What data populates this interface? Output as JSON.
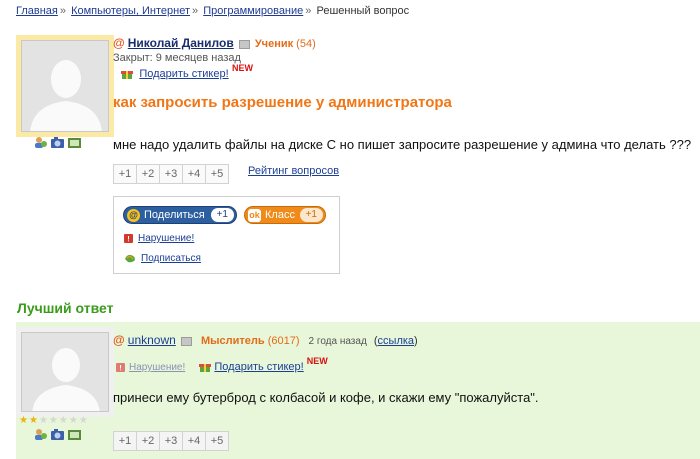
{
  "breadcrumb": {
    "items": [
      "Главная",
      "Компьютеры, Интернет",
      "Программирование"
    ],
    "current": "Решенный вопрос",
    "separator": "»"
  },
  "question": {
    "author": {
      "name": "Николай Данилов",
      "rank": "Ученик",
      "points": "(54)"
    },
    "closed": "Закрыт: 9 месяцев назад",
    "sticker_link": "Подарить стикер!",
    "new_badge": "NEW",
    "title": "как запросить разрешение у администратора",
    "text": "мне надо удалить файлы на диске С но пишет запросите разрешение у админа что делать ???",
    "votes": [
      "+1",
      "+2",
      "+3",
      "+4",
      "+5"
    ],
    "rating_link": "Рейтинг вопросов",
    "share": {
      "share_label": "Поделиться",
      "share_count": "+1",
      "class_label": "Класс",
      "class_count": "+1",
      "violation": "Нарушение!",
      "subscribe": "Подписаться"
    }
  },
  "best_answer": {
    "heading": "Лучший ответ",
    "author": {
      "name": "unknown",
      "rank": "Мыслитель",
      "points": "(6017)"
    },
    "time": "2 года назад",
    "link": "ссылка",
    "violation": "Нарушение!",
    "sticker_link": "Подарить стикер!",
    "new_badge": "NEW",
    "text": "принеси ему бутерброд с колбасой и кофе, и скажи ему \"пожалуйста\".",
    "votes": [
      "+1",
      "+2",
      "+3",
      "+4",
      "+5"
    ],
    "stars_filled": 2,
    "stars_total": 7
  },
  "colors": {
    "link": "#1c3f96",
    "title_orange": "#f07616",
    "rank_orange": "#e56b1a",
    "best_green": "#3b9b1c",
    "answer_bg": "#e8f6d9"
  },
  "icons": [
    "at-icon",
    "mailbox-icon",
    "gift-icon",
    "user-icon",
    "camera-icon",
    "video-icon",
    "alert-icon",
    "subscribe-icon",
    "star-icon"
  ]
}
